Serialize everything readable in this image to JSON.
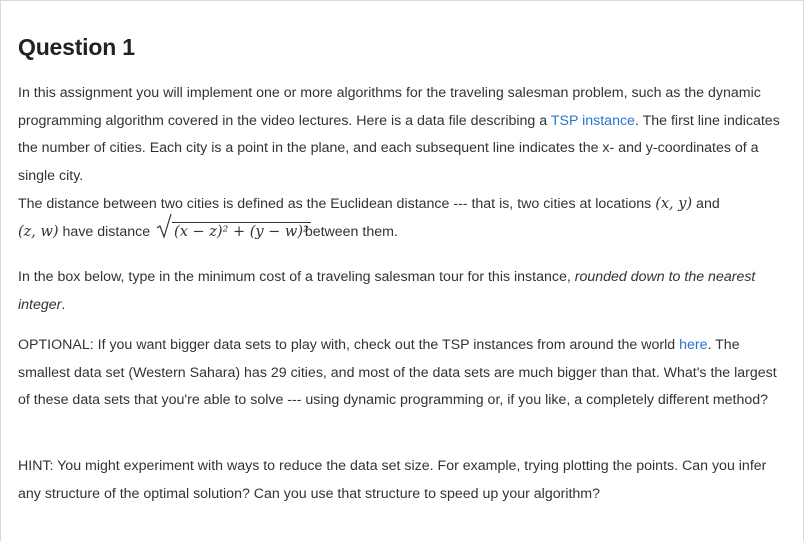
{
  "title": "Question 1",
  "para1": {
    "before_link": "In this assignment you will implement one or more algorithms for the traveling salesman problem, such as the dynamic programming algorithm covered in the video lectures. Here is a data file describing a ",
    "link": "TSP instance",
    "after_link": ". The first line indicates the number of cities. Each city is a point in the plane, and each subsequent line indicates the x- and y-coordinates of a single city."
  },
  "para2": {
    "text1": "The distance between two cities is defined as the Euclidean distance --- that is, two cities at locations ",
    "math1": "(x, y)",
    "text2": " and ",
    "math2": "(z, w)",
    "text3": " have distance ",
    "radicand": "(x − z)² + (y − w)²",
    "text4": "between them."
  },
  "para3": {
    "text": "In the box below, type in the minimum cost of a traveling salesman tour for this instance, ",
    "emphasis": "rounded down to the nearest integer",
    "end": "."
  },
  "para4": {
    "before_link": "OPTIONAL: If you want bigger data sets to play with, check out the TSP instances from around the world ",
    "link": "here",
    "after_link": ". The smallest data set (Western Sahara) has 29 cities, and most of the data sets are much bigger than that. What's the largest of these data sets that you're able to solve --- using dynamic programming or, if you like, a completely different method?"
  },
  "para5": {
    "text": "HINT: You might experiment with ways to reduce the data set size. For example, trying plotting the points. Can you infer any structure of the optimal solution? Can you use that structure to speed up your algorithm?"
  },
  "colors": {
    "link": "#2a73cc",
    "text": "#333333",
    "border": "#d9d9d9"
  }
}
